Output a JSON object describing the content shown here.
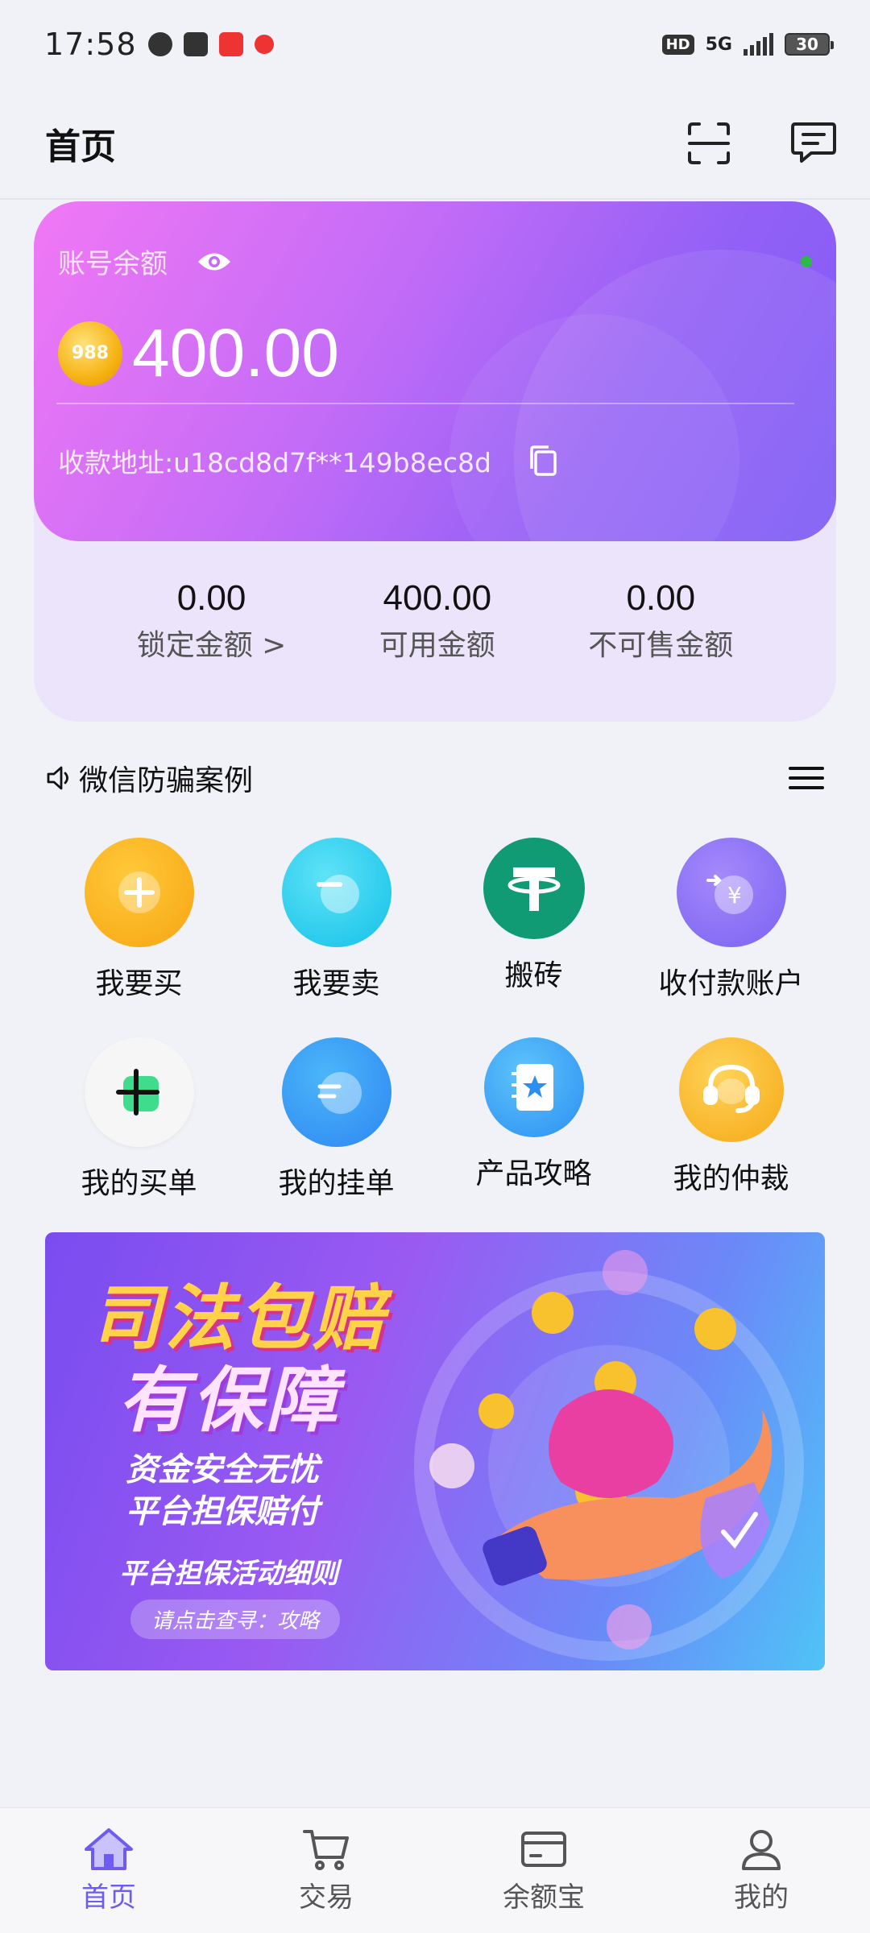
{
  "status_bar": {
    "time": "17:58",
    "hd": "HD",
    "network": "5G",
    "battery": "30"
  },
  "header": {
    "title": "首页"
  },
  "balance_card": {
    "label": "账号余额",
    "coin_text": "988",
    "amount": "400.00",
    "address": "收款地址:u18cd8d7f**149b8ec8d"
  },
  "stats": [
    {
      "value": "0.00",
      "label": "锁定金额 >"
    },
    {
      "value": "400.00",
      "label": "可用金额"
    },
    {
      "value": "0.00",
      "label": "不可售金额"
    }
  ],
  "notice": {
    "text": "微信防骗案例"
  },
  "grid": [
    {
      "label": "我要买",
      "icon": "plus-coin-icon"
    },
    {
      "label": "我要卖",
      "icon": "minus-coin-icon"
    },
    {
      "label": "搬砖",
      "icon": "tether-icon"
    },
    {
      "label": "收付款账户",
      "icon": "yuan-exchange-icon"
    },
    {
      "label": "我的买单",
      "icon": "buy-order-icon"
    },
    {
      "label": "我的挂单",
      "icon": "sell-order-icon"
    },
    {
      "label": "产品攻略",
      "icon": "guide-book-icon"
    },
    {
      "label": "我的仲裁",
      "icon": "headset-icon"
    }
  ],
  "banner": {
    "title1": "司法包赔",
    "title2": "有保障",
    "sub1": "资金安全无忧",
    "sub2": "平台担保赔付",
    "rule": "平台担保活动细则",
    "pill": "请点击查寻：攻略"
  },
  "nav": [
    {
      "label": "首页",
      "active": true
    },
    {
      "label": "交易",
      "active": false
    },
    {
      "label": "余额宝",
      "active": false
    },
    {
      "label": "我的",
      "active": false
    }
  ],
  "colors": {
    "accent": "#6d5bf2",
    "card_start": "#f178f5",
    "card_end": "#7d5bf6"
  }
}
